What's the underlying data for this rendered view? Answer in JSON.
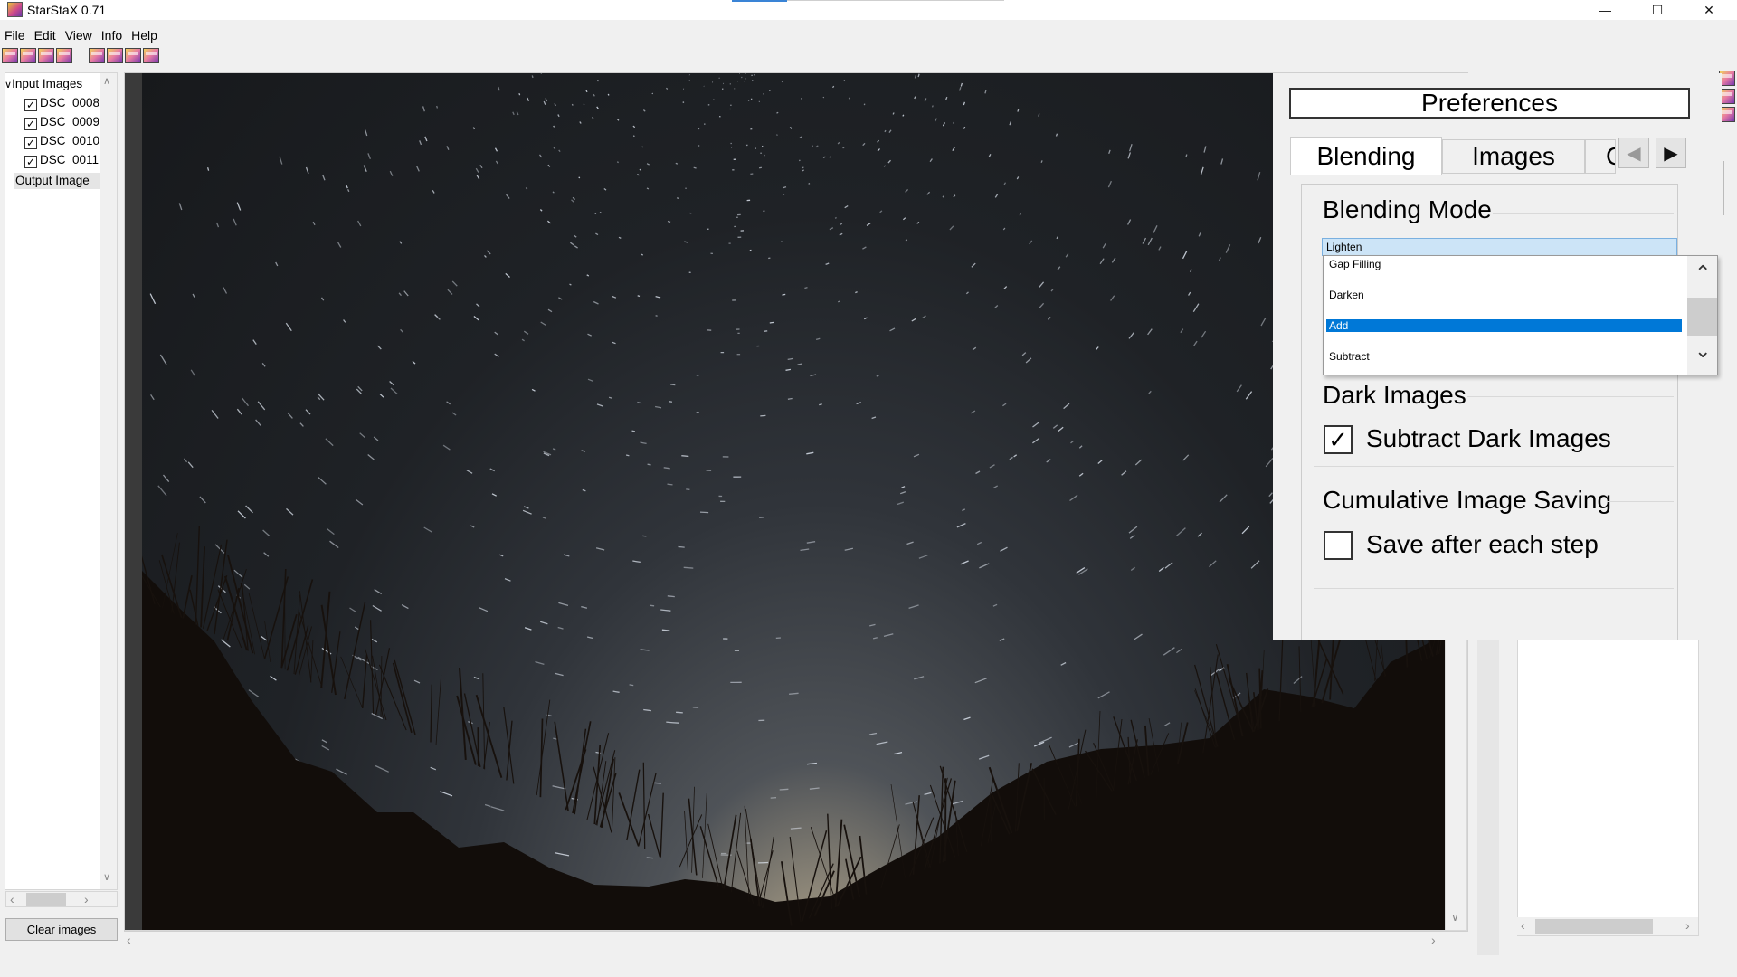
{
  "window": {
    "title": "StarStaX 0.71"
  },
  "window_controls": {
    "minimize": "—",
    "maximize": "☐",
    "close": "✕"
  },
  "menu": [
    {
      "label": "File"
    },
    {
      "label": "Edit"
    },
    {
      "label": "View"
    },
    {
      "label": "Info"
    },
    {
      "label": "Help"
    }
  ],
  "toolbar": {
    "icons": [
      "open-images-icon",
      "open-dark-icon",
      "save-icon",
      "save-as-icon",
      "zoom-in-icon",
      "zoom-out-icon",
      "zoom-fit-icon",
      "zoom-100-icon"
    ]
  },
  "tree": {
    "root_label": "Input Images",
    "expand_glyph": "∨",
    "items": [
      {
        "label": "DSC_0008",
        "checked": true,
        "check_glyph": "✓"
      },
      {
        "label": "DSC_0009",
        "checked": true,
        "check_glyph": "✓"
      },
      {
        "label": "DSC_0010",
        "checked": true,
        "check_glyph": "✓"
      },
      {
        "label": "DSC_0011",
        "checked": true,
        "check_glyph": "✓"
      }
    ],
    "output_label": "Output Image"
  },
  "buttons": {
    "clear_images": "Clear images"
  },
  "preferences": {
    "title": "Preferences",
    "tabs": [
      {
        "label": "Blending",
        "active": true
      },
      {
        "label": "Images",
        "active": false
      },
      {
        "label": "G",
        "active": false
      }
    ],
    "blending_mode": {
      "title": "Blending Mode",
      "selected": "Lighten",
      "options": [
        {
          "label": "Gap Filling",
          "highlighted": false
        },
        {
          "label": "Darken",
          "highlighted": false
        },
        {
          "label": "Add",
          "highlighted": true
        },
        {
          "label": "Subtract",
          "highlighted": false
        }
      ]
    },
    "dark_images": {
      "title": "Dark Images",
      "checkbox_label": "Subtract Dark Images",
      "checked": true,
      "check_glyph": "✓"
    },
    "cumulative": {
      "title": "Cumulative Image Saving",
      "checkbox_label": "Save after each step",
      "checked": false
    }
  },
  "colors": {
    "accent": "#0078d7",
    "title_accent": "#3a84d6",
    "dropdown_sel": "#cce4f7"
  }
}
